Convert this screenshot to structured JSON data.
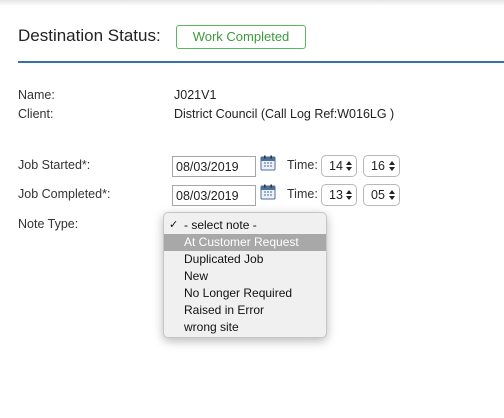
{
  "header": {
    "title": "Destination Status:",
    "status": "Work Completed",
    "status_color": "#5cb85c",
    "accent_color": "#3a6fa6"
  },
  "details": {
    "name_label": "Name:",
    "name_value": "J021V1",
    "client_label": "Client:",
    "client_value": "District Council (Call Log Ref:W016LG )"
  },
  "job_started": {
    "label": "Job Started*:",
    "date": "08/03/2019",
    "calendar_icon": "calendar-icon",
    "time_label": "Time:",
    "hour": "14",
    "minute": "16"
  },
  "job_completed": {
    "label": "Job Completed*:",
    "date": "08/03/2019",
    "calendar_icon": "calendar-icon",
    "time_label": "Time:",
    "hour": "13",
    "minute": "05"
  },
  "note_type": {
    "label": "Note Type:",
    "selected": "- select note -",
    "highlighted": "At Customer Request",
    "options": [
      "- select note -",
      "At Customer Request",
      "Duplicated Job",
      "New",
      "No Longer Required",
      "Raised in Error",
      "wrong site"
    ]
  }
}
